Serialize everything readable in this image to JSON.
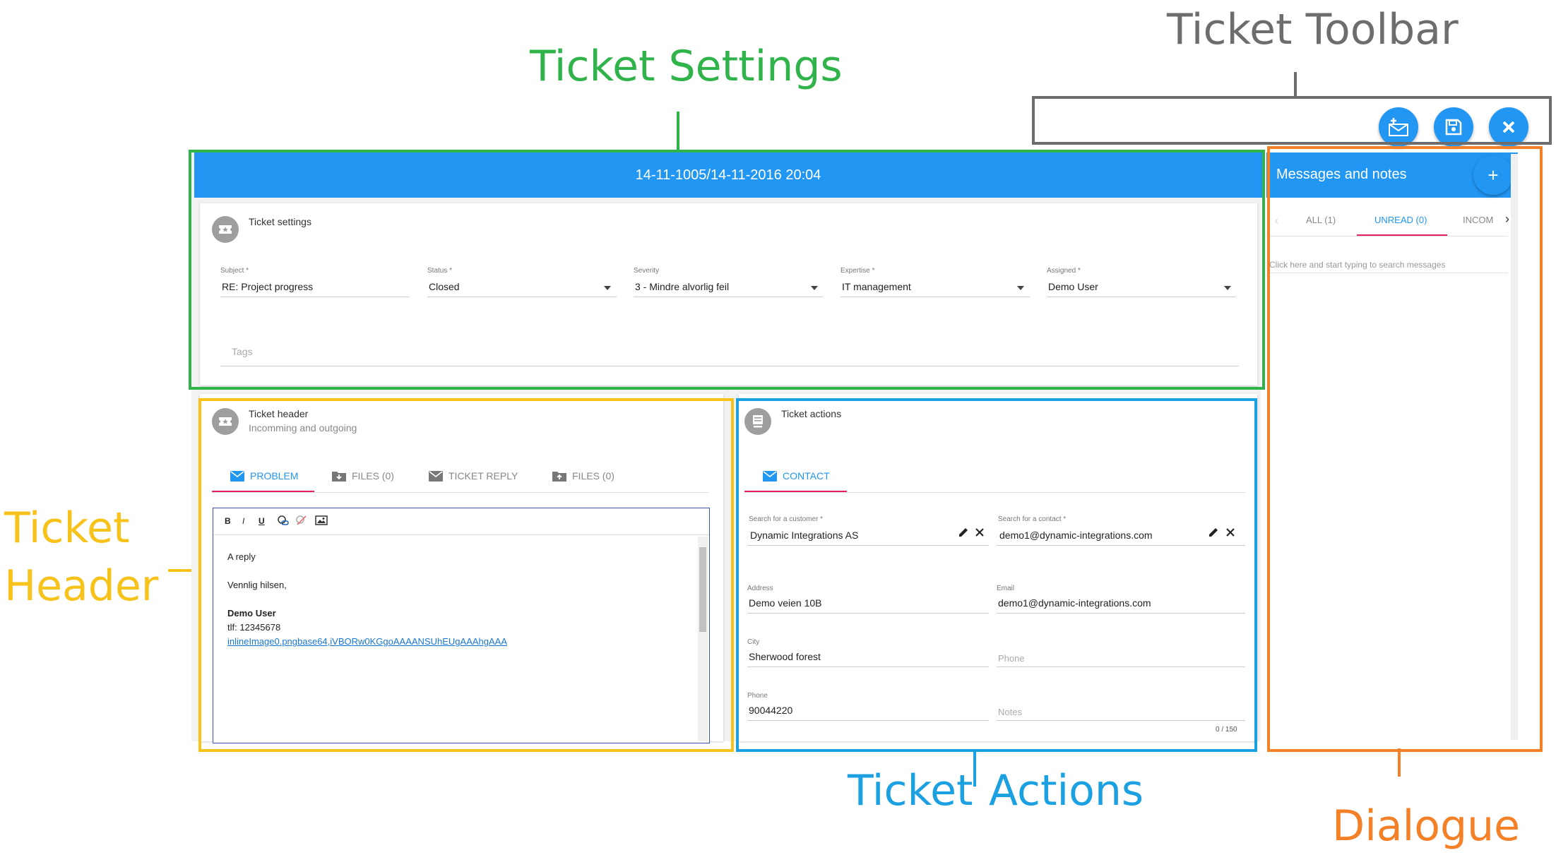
{
  "annotations": {
    "ticket_settings": "Ticket Settings",
    "ticket_toolbar": "Ticket Toolbar",
    "ticket_header_line1": "Ticket",
    "ticket_header_line2": "Header",
    "ticket_actions_1": "Ticket",
    "ticket_actions_2": "Actions",
    "dialogue": "Dialogue"
  },
  "colors": {
    "primary": "#2196f3",
    "accent_tab": "#e91e63",
    "ann_green": "#2fb34a",
    "ann_gray": "#6d6d6d",
    "ann_yellow": "#f7c21a",
    "ann_blue": "#1ba0e1",
    "ann_orange": "#f48128"
  },
  "toolbar": {
    "buttons": [
      {
        "icon": "mail-add-icon"
      },
      {
        "icon": "save-icon"
      },
      {
        "icon": "close-icon"
      }
    ]
  },
  "ticket": {
    "title": "14-11-1005/14-11-2016 20:04",
    "settings": {
      "section_title": "Ticket settings",
      "icon": "ticket-icon",
      "fields": {
        "subject": {
          "label": "Subject *",
          "value": "RE: Project progress"
        },
        "status": {
          "label": "Status *",
          "value": "Closed"
        },
        "severity": {
          "label": "Severity",
          "value": "3 - Mindre alvorlig feil"
        },
        "expertise": {
          "label": "Expertise *",
          "value": "IT management"
        },
        "assigned": {
          "label": "Assigned *",
          "value": "Demo User"
        }
      },
      "tags_placeholder": "Tags"
    },
    "header": {
      "section_title": "Ticket header",
      "section_subtitle": "Incomming and outgoing",
      "icon": "ticket-icon",
      "tabs": [
        {
          "label": "PROBLEM",
          "icon": "mail-icon",
          "active": true
        },
        {
          "label": "FILES (0)",
          "icon": "download-folder-icon",
          "active": false
        },
        {
          "label": "TICKET REPLY",
          "icon": "mail-icon",
          "active": false
        },
        {
          "label": "FILES (0)",
          "icon": "upload-folder-icon",
          "active": false
        }
      ],
      "editor_toolbar": {
        "bold": "B",
        "italic": "I",
        "underline": "U"
      },
      "editor_content": {
        "line1": "A reply",
        "line2": "Vennlig hilsen,",
        "name": "Demo User",
        "phone": "tlf: 12345678",
        "link": "inlineImage0.pngbase64,iVBORw0KGgoAAAANSUhEUgAAAhgAAA"
      }
    },
    "actions": {
      "section_title": "Ticket actions",
      "icon": "ticket-actions-icon",
      "tabs": [
        {
          "label": "CONTACT",
          "icon": "mail-icon",
          "active": true
        }
      ],
      "fields": {
        "customer": {
          "label": "Search for a customer *",
          "value": "Dynamic Integrations AS"
        },
        "contact": {
          "label": "Search for a contact *",
          "value": "demo1@dynamic-integrations.com"
        },
        "address": {
          "label": "Address",
          "value": "Demo veien 10B"
        },
        "email": {
          "label": "Email",
          "value": "demo1@dynamic-integrations.com"
        },
        "city": {
          "label": "City",
          "value": "Sherwood forest"
        },
        "phone_placeholder": "Phone",
        "phone": {
          "label": "Phone",
          "value": "90044220"
        },
        "notes_placeholder": "Notes",
        "notes_counter": "0 / 150"
      }
    }
  },
  "messages": {
    "title": "Messages and notes",
    "add_label": "+",
    "tabs": [
      {
        "label": "ALL (1)",
        "active": false
      },
      {
        "label": "UNREAD (0)",
        "active": true
      },
      {
        "label": "INCOM",
        "active": false
      }
    ],
    "search_placeholder": "Click here and start typing to search messages"
  }
}
